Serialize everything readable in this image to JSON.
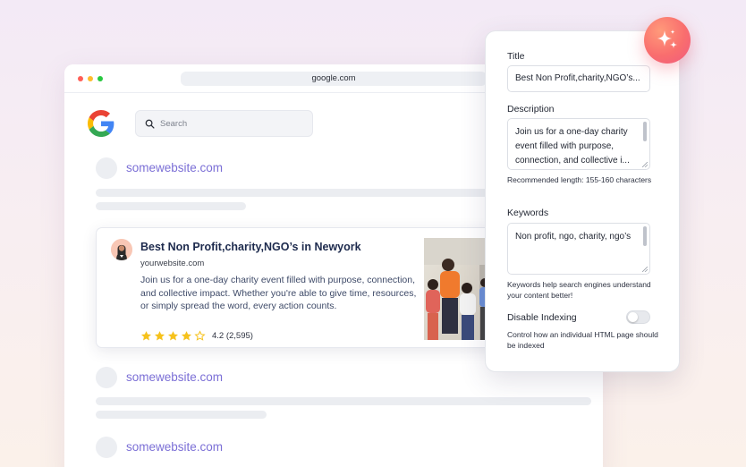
{
  "browser": {
    "url": "google.com",
    "search": {
      "placeholder": "Search"
    }
  },
  "results": {
    "site_label": "somewebsite.com",
    "featured": {
      "title": "Best Non Profit,charity,NGO’s in Newyork",
      "url": "yourwebsite.com",
      "description": "Us for a one-day charity event filled with purpose, connection, and collective impact. Whether you're able to give time, resources, or simply spread the word, every action counts.",
      "description_full": "Join us for a one-day charity event filled with purpose, connection, and collective impact. Whether you're able to give time, resources, or simply spread the word, every action counts.",
      "rating_text": "4.2 (2,595)",
      "rating": 4.2,
      "stars_filled": 4,
      "stars_total": 5
    }
  },
  "seo_panel": {
    "title_label": "Title",
    "title_value": "Best Non Profit,charity,NGO’s...",
    "description_label": "Description",
    "description_value": "Join us for a one-day charity event filled with purpose, connection, and collective i...",
    "description_hint": "Recommended length: 155-160 characters",
    "keywords_label": "Keywords",
    "keywords_value": "Non profit, ngo, charity, ngo’s",
    "keywords_hint": "Keywords help search engines understand your content better!",
    "indexing_label": "Disable Indexing",
    "indexing_enabled": false,
    "indexing_hint": "Control how an individual HTML page should be indexed"
  },
  "colors": {
    "link": "#7b6fd6",
    "title": "#1d2a4d",
    "star": "#f6c21c",
    "accent_gradient_start": "#ff9a7a",
    "accent_gradient_end": "#f05a7e"
  },
  "icons": {
    "search": "search-icon",
    "sparkle": "sparkle-icon",
    "google": "google-logo"
  }
}
